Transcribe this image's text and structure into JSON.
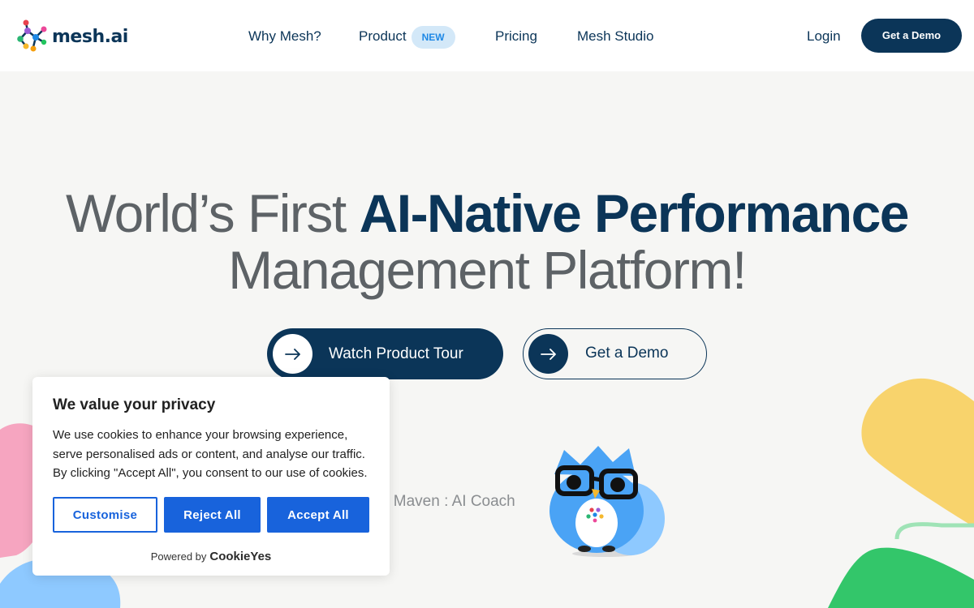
{
  "brand": {
    "name": "mesh.ai"
  },
  "nav": {
    "items": [
      {
        "label": "Why Mesh?"
      },
      {
        "label": "Product",
        "badge": "NEW"
      },
      {
        "label": "Pricing"
      },
      {
        "label": "Mesh Studio"
      }
    ],
    "login": "Login",
    "cta": "Get a Demo"
  },
  "hero": {
    "title_part1": "World’s First ",
    "title_accent": "AI-Native Performance",
    "title_part2": "Management Platform!",
    "primary_button": "Watch Product Tour",
    "secondary_button": "Get a Demo",
    "coach_caption": "y Maven : AI Coach"
  },
  "cookie": {
    "title": "We value your privacy",
    "body": "We use cookies to enhance your browsing experience, serve personalised ads or content, and analyse our traffic. By clicking \"Accept All\", you consent to our use of cookies.",
    "customise": "Customise",
    "reject": "Reject All",
    "accept": "Accept All",
    "powered_by": "Powered by",
    "powered_brand": "CookieYes"
  },
  "colors": {
    "brand_navy": "#0b3558",
    "badge_bg": "#d3e8f8",
    "badge_text": "#1e88e5",
    "cookie_blue": "#1863dc",
    "page_bg": "#f6f6f4",
    "blob_pink": "#f6a5c0",
    "blob_yellow": "#f8d36c",
    "blob_green": "#33c66a",
    "blob_blue": "#8ec9ff"
  },
  "icons": [
    "mesh-logo-icon",
    "arrow-right-icon",
    "owl-mascot-icon"
  ]
}
